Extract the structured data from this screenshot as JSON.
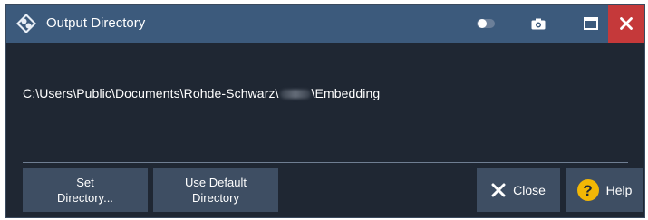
{
  "window": {
    "title": "Output Directory",
    "colors": {
      "titlebar": "#3c5a7c",
      "body": "#1f2733",
      "close_button": "#c5393a",
      "button": "#3e4e63",
      "help_icon": "#f2b705"
    }
  },
  "titlebar_icons": [
    "toggle-icon",
    "camera-icon",
    "maximize-icon",
    "close-icon"
  ],
  "path": {
    "prefix": "C:\\Users\\Public\\Documents\\Rohde-Schwarz\\",
    "suffix": "\\Embedding"
  },
  "buttons": {
    "set_directory": "Set\nDirectory...",
    "use_default_directory": "Use Default\nDirectory",
    "close": "Close",
    "help": "Help",
    "help_icon_glyph": "?"
  }
}
